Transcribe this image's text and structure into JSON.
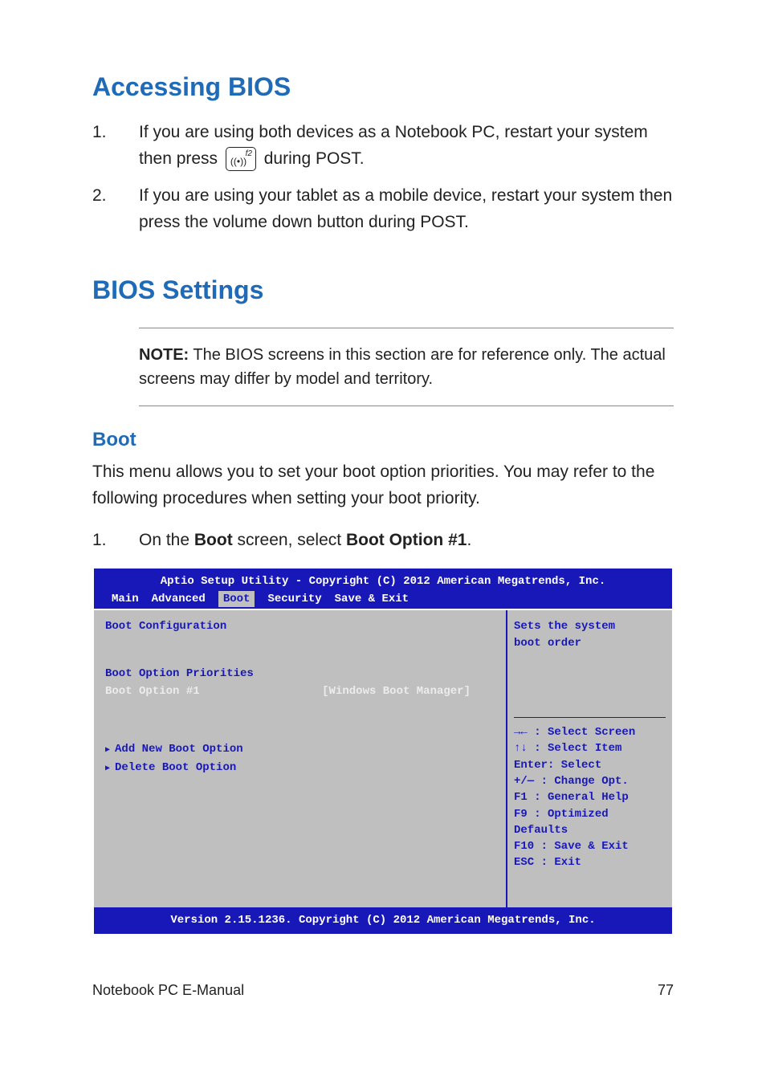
{
  "headings": {
    "accessing": "Accessing BIOS",
    "settings": "BIOS Settings",
    "boot": "Boot"
  },
  "items": {
    "item1_num": "1.",
    "item1_a": "If you are using both devices as a Notebook PC, restart your system then press ",
    "item1_b": " during POST.",
    "item2_num": "2.",
    "item2": "If you are using your tablet as a mobile device, restart your system then press the volume down button during POST.",
    "boot_num": "1.",
    "boot_a": "On the ",
    "boot_b": "Boot",
    "boot_c": " screen, select ",
    "boot_d": "Boot Option #1",
    "boot_e": "."
  },
  "key": {
    "f2": "f2",
    "wave": "((•))"
  },
  "note": {
    "label": "NOTE:",
    "text": " The BIOS screens in this section are for reference only. The actual screens may differ by model and territory."
  },
  "para_boot": "This menu allows you to set your boot option priorities. You may refer to the following procedures when setting your boot priority.",
  "bios": {
    "header": "Aptio Setup Utility - Copyright (C) 2012 American Megatrends, Inc.",
    "tabs": {
      "main": "Main",
      "advanced": "Advanced",
      "boot": "Boot",
      "security": "Security",
      "save": "Save & Exit"
    },
    "left": {
      "cfg": "Boot Configuration",
      "prio": "Boot Option Priorities",
      "opt1_label": "Boot Option #1",
      "opt1_val": "[Windows Boot Manager]",
      "add": "Add New Boot Option",
      "del": "Delete Boot Option"
    },
    "right": {
      "desc1": "Sets the system",
      "desc2": "boot order",
      "h_arrows": "→←  : Select Screen",
      "h_ud": "↑↓  : Select Item",
      "h_enter": "Enter: Select",
      "h_pm": "+/—  : Change Opt.",
      "h_f1": "F1   : General Help",
      "h_f9": "F9   : Optimized Defaults",
      "h_f10": "F10  : Save & Exit",
      "h_esc": "ESC  : Exit"
    },
    "footer": "Version 2.15.1236. Copyright (C) 2012 American Megatrends, Inc."
  },
  "footer": {
    "left": "Notebook PC E-Manual",
    "right": "77"
  }
}
